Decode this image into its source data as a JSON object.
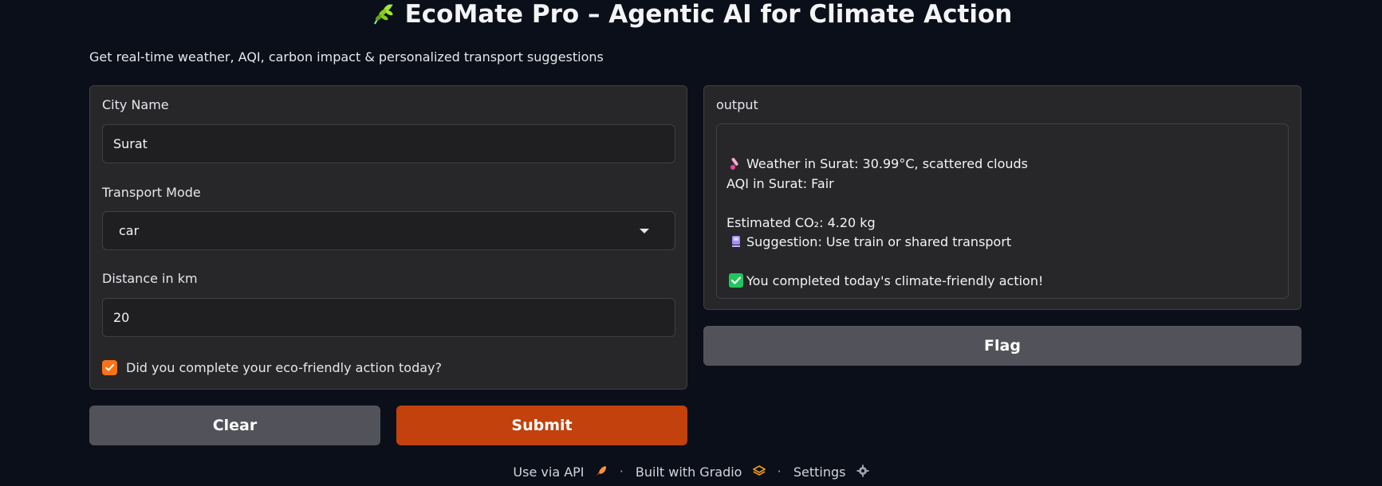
{
  "header": {
    "title": "EcoMate Pro – Agentic AI for Climate Action",
    "subtitle": "Get real-time weather, AQI, carbon impact & personalized transport suggestions"
  },
  "inputs": {
    "city_label": "City Name",
    "city_value": "Surat",
    "transport_label": "Transport Mode",
    "transport_value": "car",
    "distance_label": "Distance in km",
    "distance_value": "20",
    "checkbox_label": "Did you complete your eco-friendly action today?",
    "checkbox_checked": true
  },
  "buttons": {
    "clear": "Clear",
    "submit": "Submit",
    "flag": "Flag"
  },
  "output": {
    "label": "output",
    "weather": "Weather in Surat: 30.99°C, scattered clouds",
    "aqi": "AQI in Surat: Fair",
    "co2": "Estimated CO₂: 4.20 kg",
    "suggestion": "Suggestion: Use train or shared transport",
    "completed": "You completed today's climate-friendly action!"
  },
  "footer": {
    "api": "Use via API",
    "built": "Built with Gradio",
    "settings": "Settings"
  },
  "colors": {
    "background": "#0b0f19",
    "panel": "#27272a",
    "primary": "#c2410c",
    "secondary": "#52525b",
    "checkbox": "#f97316"
  }
}
